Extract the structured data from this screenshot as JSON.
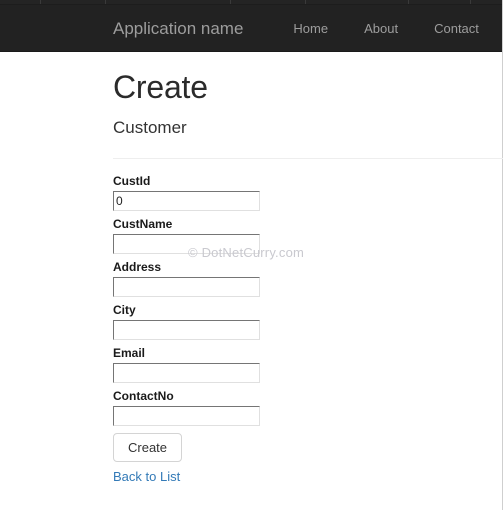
{
  "navbar": {
    "brand": "Application name",
    "links": [
      {
        "label": "Home"
      },
      {
        "label": "About"
      },
      {
        "label": "Contact"
      }
    ],
    "background_color": "#222222",
    "text_color": "#9d9d9d"
  },
  "page": {
    "title": "Create",
    "subtitle": "Customer"
  },
  "form": {
    "fields": [
      {
        "label": "CustId",
        "value": "0",
        "placeholder": ""
      },
      {
        "label": "CustName",
        "value": "",
        "placeholder": ""
      },
      {
        "label": "Address",
        "value": "",
        "placeholder": ""
      },
      {
        "label": "City",
        "value": "",
        "placeholder": ""
      },
      {
        "label": "Email",
        "value": "",
        "placeholder": ""
      },
      {
        "label": "ContactNo",
        "value": "",
        "placeholder": ""
      }
    ],
    "submit_label": "Create",
    "back_link_label": "Back to List",
    "link_color": "#337ab7"
  },
  "watermark": {
    "text": "© DotNetCurry.com",
    "color": "#c9c9cf"
  }
}
